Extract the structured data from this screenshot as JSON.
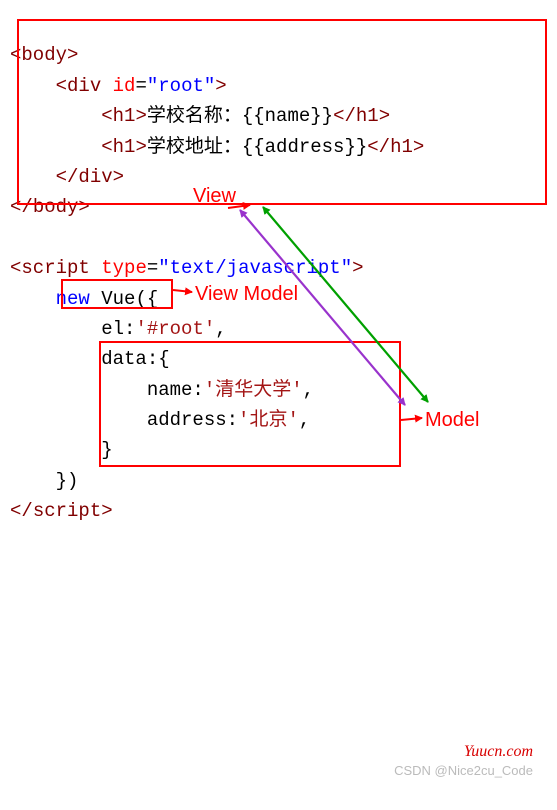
{
  "code": {
    "l1": {
      "open": "<",
      "tag": "body",
      "close": ">"
    },
    "l2": {
      "open": "<",
      "tag": "div",
      "sp": " ",
      "attr": "id",
      "eq": "=",
      "q1": "\"",
      "val": "root",
      "q2": "\"",
      "close": ">"
    },
    "l3": {
      "open": "<",
      "tag": "h1",
      "gt": ">",
      "txt": "学校名称：{{name}}",
      "open2": "</",
      "tag2": "h1",
      "gt2": ">"
    },
    "l4": {
      "open": "<",
      "tag": "h1",
      "gt": ">",
      "txt": "学校地址：{{address}}",
      "open2": "</",
      "tag2": "h1",
      "gt2": ">"
    },
    "l5": {
      "open": "</",
      "tag": "div",
      "close": ">"
    },
    "l6": {
      "open": "</",
      "tag": "body",
      "close": ">"
    },
    "l7": {
      "open": "<",
      "tag": "script",
      "sp": " ",
      "attr": "type",
      "eq": "=",
      "q1": "\"",
      "val": "text/javascript",
      "q2": "\"",
      "close": ">"
    },
    "l8": {
      "kw": "new",
      "sp": " ",
      "fn": "Vue",
      "paren": "({"
    },
    "l9": {
      "key": "el:",
      "val": "'#root'",
      "comma": ","
    },
    "l10": {
      "key": "data:{"
    },
    "l11": {
      "key": "name:",
      "val": "'清华大学'",
      "comma": ","
    },
    "l12": {
      "key": "address:",
      "val": "'北京'",
      "comma": ","
    },
    "l13": {
      "close": "}"
    },
    "l14": {
      "close": "})"
    },
    "l15": {
      "open": "</",
      "tag": "script",
      "close": ">"
    }
  },
  "labels": {
    "view": "View",
    "vm": "View Model",
    "model": "Model"
  },
  "watermarks": {
    "site": "Yuucn.com",
    "csdn": "CSDN @Nice2cu_Code"
  }
}
